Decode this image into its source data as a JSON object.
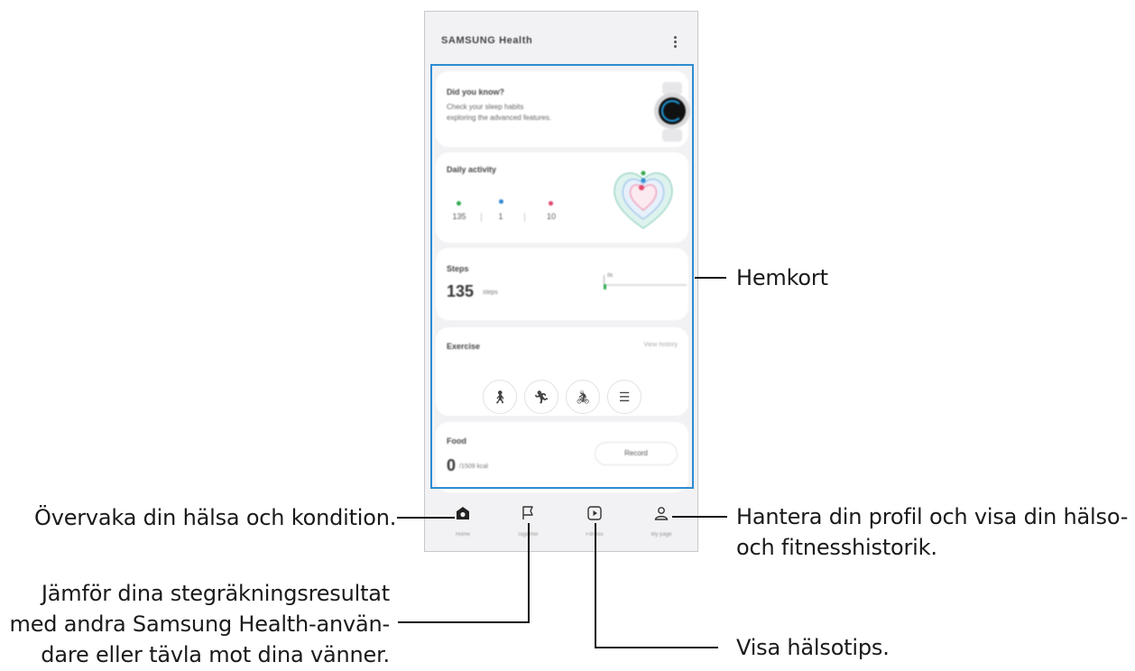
{
  "app": {
    "title": "SAMSUNG Health",
    "accent_color": "#2e8bd1"
  },
  "cards": {
    "did_you_know": {
      "title": "Did you know?",
      "text_line1": "Check your sleep habits",
      "text_line2": "exploring the advanced features."
    },
    "daily_activity": {
      "title": "Daily activity",
      "stats": [
        {
          "icon": "steps-icon",
          "value": "135",
          "color": "#2fa84f"
        },
        {
          "icon": "active-time-icon",
          "value": "1",
          "color": "#2d87d3"
        },
        {
          "icon": "calories-icon",
          "value": "10",
          "color": "#e2456a"
        }
      ]
    },
    "steps": {
      "title": "Steps",
      "value": "135",
      "unit": "steps",
      "goal_tick": "6k",
      "progress_fraction": 0.02
    },
    "exercise": {
      "title": "Exercise",
      "view_history": "View history",
      "buttons": [
        "walking-icon",
        "running-icon",
        "cycling-icon",
        "list-icon"
      ]
    },
    "food": {
      "title": "Food",
      "value": "0",
      "unit": "/1509 kcal",
      "record_label": "Record"
    }
  },
  "bottom_nav": {
    "items": [
      {
        "label": "Home",
        "icon": "home-icon"
      },
      {
        "label": "Together",
        "icon": "flag-icon"
      },
      {
        "label": "Fitness",
        "icon": "play-icon"
      },
      {
        "label": "My page",
        "icon": "person-icon"
      }
    ]
  },
  "callouts": {
    "home_cards": "Hemkort",
    "home_tab": "Övervaka din hälsa och kondition.",
    "together_tab": {
      "line1": "Jämför dina stegräkningsresultat",
      "line2": "med andra Samsung Health-använ-",
      "line3": "dare eller tävla mot dina vänner."
    },
    "fitness_tab": "Visa hälsotips.",
    "my_page_tab": {
      "line1": "Hantera din profil och visa din hälso-",
      "line2": "och fitnesshistorik."
    }
  }
}
